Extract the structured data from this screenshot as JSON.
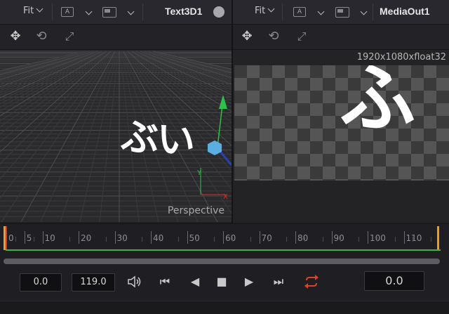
{
  "left_viewer": {
    "fit_label": "Fit",
    "btn_a_label": "A",
    "node_title": "Text3D1",
    "viewport_label": "Perspective",
    "scene_text": "ぶい"
  },
  "right_viewer": {
    "fit_label": "Fit",
    "btn_a_label": "A",
    "node_title": "MediaOut1",
    "resolution": "1920x1080xfloat32",
    "scene_text": "ふ"
  },
  "timeline": {
    "ticks": [
      "0",
      "5",
      "10",
      "20",
      "30",
      "40",
      "50",
      "60",
      "70",
      "80",
      "90",
      "100",
      "110"
    ]
  },
  "transport": {
    "start_time": "0.0",
    "end_time": "119.0",
    "current_time": "0.0"
  },
  "colors": {
    "loop_active": "#e0402a",
    "playhead_range": "#3bb54a",
    "range_marker": "#e8a020",
    "gizmo_green": "#2cc24a",
    "gizmo_red": "#d03030",
    "gizmo_blue": "#5aaee0"
  },
  "icons": {
    "move": "move-icon",
    "rotate": "rotate-icon",
    "scale": "scale-icon",
    "speaker": "speaker-icon",
    "loop": "loop-icon"
  }
}
